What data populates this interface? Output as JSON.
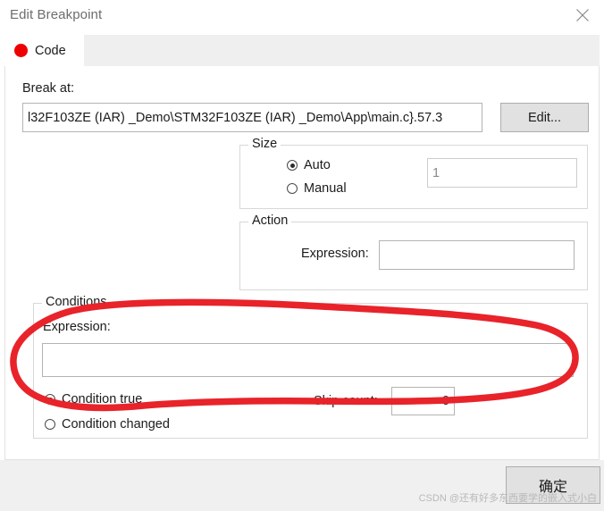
{
  "window": {
    "title": "Edit Breakpoint",
    "close_icon": "close-icon"
  },
  "tabs": [
    {
      "label": "Code",
      "icon": "breakpoint-red-dot-icon",
      "active": true
    }
  ],
  "break_at": {
    "label": "Break at:",
    "value": "l32F103ZE (IAR) _Demo\\STM32F103ZE (IAR) _Demo\\App\\main.c}.57.3",
    "edit_button_label": "Edit..."
  },
  "size_group": {
    "title": "Size",
    "options": [
      {
        "label": "Auto",
        "selected": true
      },
      {
        "label": "Manual",
        "selected": false
      }
    ],
    "value": "1",
    "value_enabled": false
  },
  "action_group": {
    "title": "Action",
    "expression_label": "Expression:",
    "expression_value": "",
    "expression_placeholder": ""
  },
  "conditions_group": {
    "title": "Conditions",
    "expression_label": "Expression:",
    "expression_value": "",
    "expression_placeholder": "",
    "options": [
      {
        "label": "Condition true",
        "selected": true
      },
      {
        "label": "Condition changed",
        "selected": false
      }
    ],
    "skip_count_label": "Skip count:",
    "skip_count_value": "0"
  },
  "footer": {
    "ok_label": "确定",
    "watermark": "CSDN @还有好多东西要学的嵌入式小白"
  },
  "colors": {
    "breakpoint_red": "#ee0000",
    "annotation_red": "#e8232a",
    "title_text": "#6d6d6d",
    "panel_bg": "#ffffff",
    "footer_bg": "#f0f0f0",
    "tabstrip_bg": "#efefef"
  }
}
